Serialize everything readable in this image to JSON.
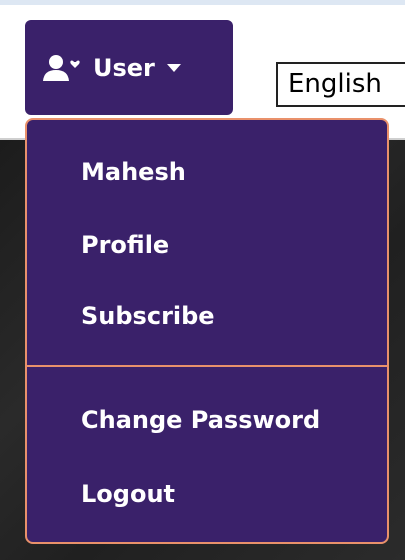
{
  "user_menu": {
    "button_label": "User",
    "icon": "user-friends-icon",
    "caret": "caret-down-icon",
    "items_primary": [
      "Mahesh",
      "Profile",
      "Subscribe"
    ],
    "items_secondary": [
      "Change Password",
      "Logout"
    ]
  },
  "language_select": {
    "selected": "English"
  },
  "colors": {
    "menu_bg": "#3a216a",
    "menu_border": "#e9916b",
    "text": "#ffffff"
  }
}
